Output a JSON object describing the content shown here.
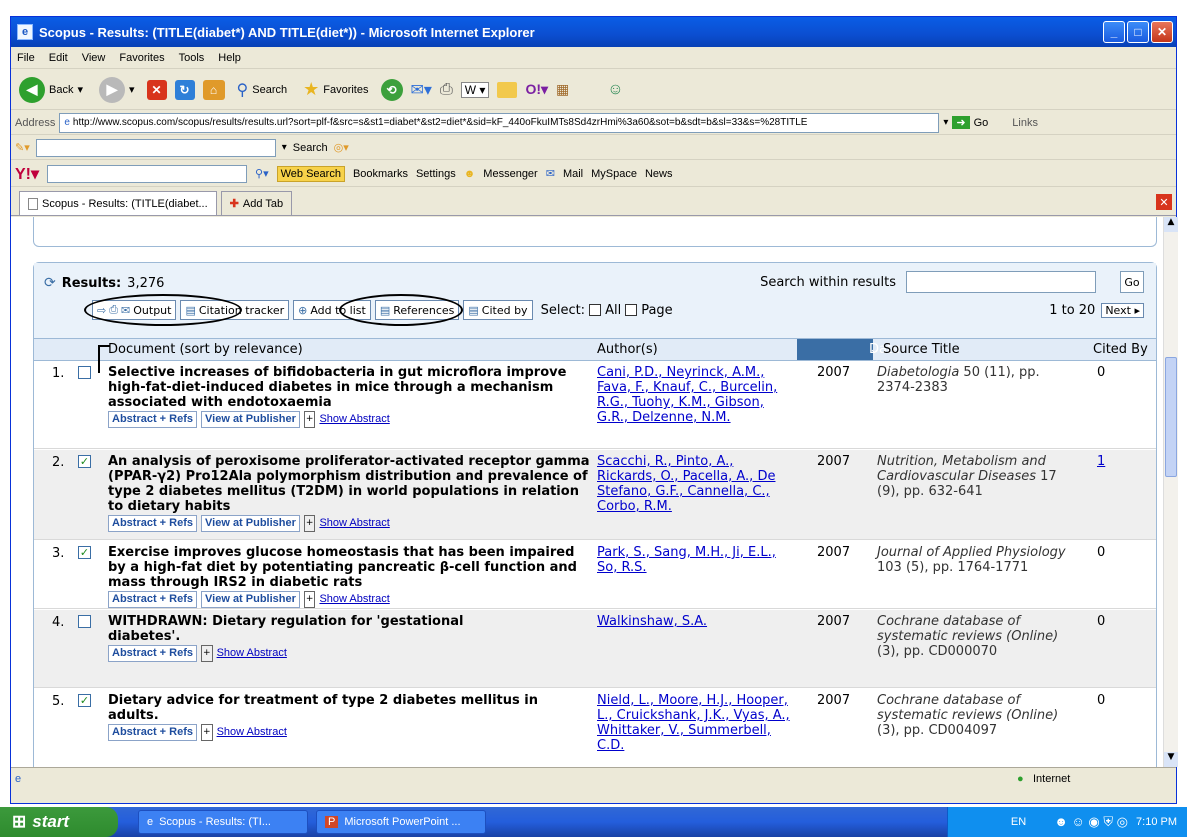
{
  "window": {
    "title": "Scopus - Results: (TITLE(diabet*) AND TITLE(diet*)) - Microsoft Internet Explorer"
  },
  "menu": [
    "File",
    "Edit",
    "View",
    "Favorites",
    "Tools",
    "Help"
  ],
  "toolbar": {
    "back": "Back",
    "search": "Search",
    "favorites": "Favorites"
  },
  "address": {
    "label": "Address",
    "url": "http://www.scopus.com/scopus/results/results.url?sort=plf-f&src=s&st1=diabet*&st2=diet*&sid=kF_440oFkuIMTs8Sd4zrHmi%3a60&sot=b&sdt=b&sl=33&s=%28TITLE",
    "go": "Go",
    "links": "Links"
  },
  "searchbar": {
    "search": "Search"
  },
  "yahoo": {
    "web_search": "Web Search",
    "bookmarks": "Bookmarks",
    "settings": "Settings",
    "messenger": "Messenger",
    "mail": "Mail",
    "myspace": "MySpace",
    "news": "News"
  },
  "tabs": {
    "active": "Scopus - Results: (TITLE(diabet...",
    "add": "Add Tab"
  },
  "results": {
    "label": "Results:",
    "count": "3,276",
    "within": "Search within results",
    "go": "Go",
    "output": "Output",
    "citation_tracker": "Citation tracker",
    "add_to_list": "Add to list",
    "references": "References",
    "cited_by": "Cited by",
    "select": "Select:",
    "all": "All",
    "page": "Page",
    "range": "1 to 20",
    "next": "Next"
  },
  "columns": {
    "document": "Document (sort by relevance)",
    "authors": "Author(s)",
    "date": "Date",
    "source": "Source Title",
    "cited": "Cited By"
  },
  "rows": [
    {
      "num": "1.",
      "checked": false,
      "title": "Selective increases of bifidobacteria in gut microflora improve high-fat-diet-induced diabetes in mice through a mechanism associated with endotoxaemia",
      "links": [
        "Abstract + Refs",
        "View at Publisher"
      ],
      "show": "Show Abstract",
      "authors": "Cani, P.D., Neyrinck, A.M., Fava, F., Knauf, C., Burcelin, R.G., Tuohy, K.M., Gibson, G.R., Delzenne, N.M.",
      "date": "2007",
      "source_journal": "Diabetologia",
      "source_rest": " 50 (11), pp. 2374-2383",
      "cited": "0"
    },
    {
      "num": "2.",
      "checked": true,
      "title": "An analysis of peroxisome proliferator-activated receptor gamma (PPAR-γ2) Pro12Ala polymorphism distribution and prevalence of type 2 diabetes mellitus (T2DM) in world populations in relation to dietary habits",
      "links": [
        "Abstract + Refs",
        "View at Publisher"
      ],
      "show": "Show Abstract",
      "authors": "Scacchi, R., Pinto, A., Rickards, O., Pacella, A., De Stefano, G.F., Cannella, C., Corbo, R.M.",
      "date": "2007",
      "source_journal": "Nutrition, Metabolism and Cardiovascular Diseases",
      "source_rest": " 17 (9), pp. 632-641",
      "cited": "1"
    },
    {
      "num": "3.",
      "checked": true,
      "title": "Exercise improves glucose homeostasis that has been impaired by a high-fat diet by potentiating pancreatic β-cell function and mass through IRS2 in diabetic rats",
      "links": [
        "Abstract + Refs",
        "View at Publisher"
      ],
      "show": "Show Abstract",
      "authors": "Park, S., Sang, M.H., Ji, E.L., So, R.S.",
      "date": "2007",
      "source_journal": "Journal of Applied Physiology",
      "source_rest": " 103 (5), pp. 1764-1771",
      "cited": "0"
    },
    {
      "num": "4.",
      "checked": false,
      "title": "WITHDRAWN: Dietary regulation for 'gestational diabetes'.",
      "links": [
        "Abstract + Refs"
      ],
      "show": "Show Abstract",
      "authors": "Walkinshaw, S.A.",
      "date": "2007",
      "source_journal": "Cochrane database of systematic reviews (Online)",
      "source_rest": " (3), pp. CD000070",
      "cited": "0"
    },
    {
      "num": "5.",
      "checked": true,
      "title": "Dietary advice for treatment of type 2 diabetes mellitus in adults.",
      "links": [
        "Abstract + Refs"
      ],
      "show": "Show Abstract",
      "authors": "Nield, L., Moore, H.J., Hooper, L., Cruickshank, J.K., Vyas, A., Whittaker, V., Summerbell, C.D.",
      "date": "2007",
      "source_journal": "Cochrane database of systematic reviews (Online)",
      "source_rest": " (3), pp. CD004097",
      "cited": "0"
    }
  ],
  "status": {
    "zone": "Internet"
  },
  "taskbar": {
    "start": "start",
    "items": [
      "Scopus - Results: (TI...",
      "Microsoft PowerPoint ..."
    ],
    "lang": "EN",
    "time": "7:10 PM"
  },
  "colors": {
    "xp_blue": "#0A5DE6",
    "link": "#0000CC",
    "header_bg": "#E1EBF7"
  }
}
